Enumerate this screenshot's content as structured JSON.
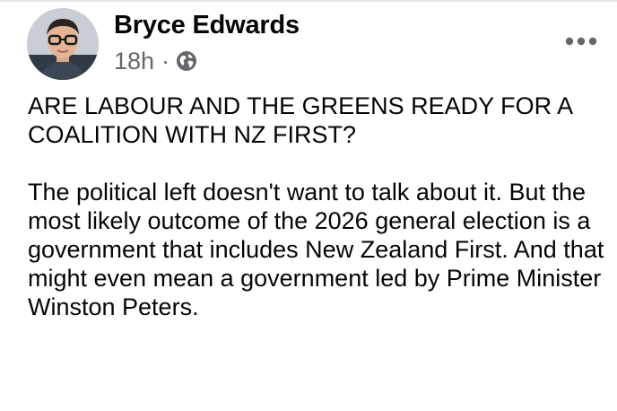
{
  "post": {
    "author_name": "Bryce Edwards",
    "timestamp": "18h",
    "separator": "·",
    "audience_icon": "globe-icon",
    "more_icon": "more-options-icon",
    "headline": "ARE LABOUR AND THE GREENS READY FOR A COALITION WITH NZ FIRST?",
    "body": "The political left doesn't want to talk about it. But the most likely outcome of the 2026 general election is a government that includes New Zealand First. And that might even mean a government led by Prime Minister Winston Peters."
  },
  "colors": {
    "text_primary": "#050505",
    "text_secondary": "#65676b",
    "divider": "#e4e6eb"
  }
}
